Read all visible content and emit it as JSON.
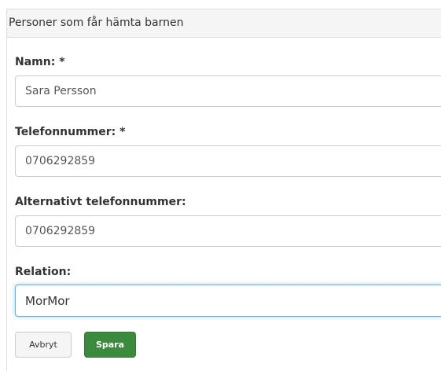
{
  "panel": {
    "title": "Personer som får hämta barnen"
  },
  "form": {
    "name": {
      "label": "Namn: *",
      "value": "Sara Persson"
    },
    "phone": {
      "label": "Telefonnummer: *",
      "value": "0706292859"
    },
    "alt_phone": {
      "label": "Alternativt telefonnummer:",
      "value": "0706292859"
    },
    "relation": {
      "label": "Relation:",
      "value": "MorMor"
    }
  },
  "buttons": {
    "cancel_label": "Avbryt",
    "save_label": "Spara"
  },
  "colors": {
    "save_button": "#3b8a3e",
    "focus_border": "#66afe9"
  }
}
